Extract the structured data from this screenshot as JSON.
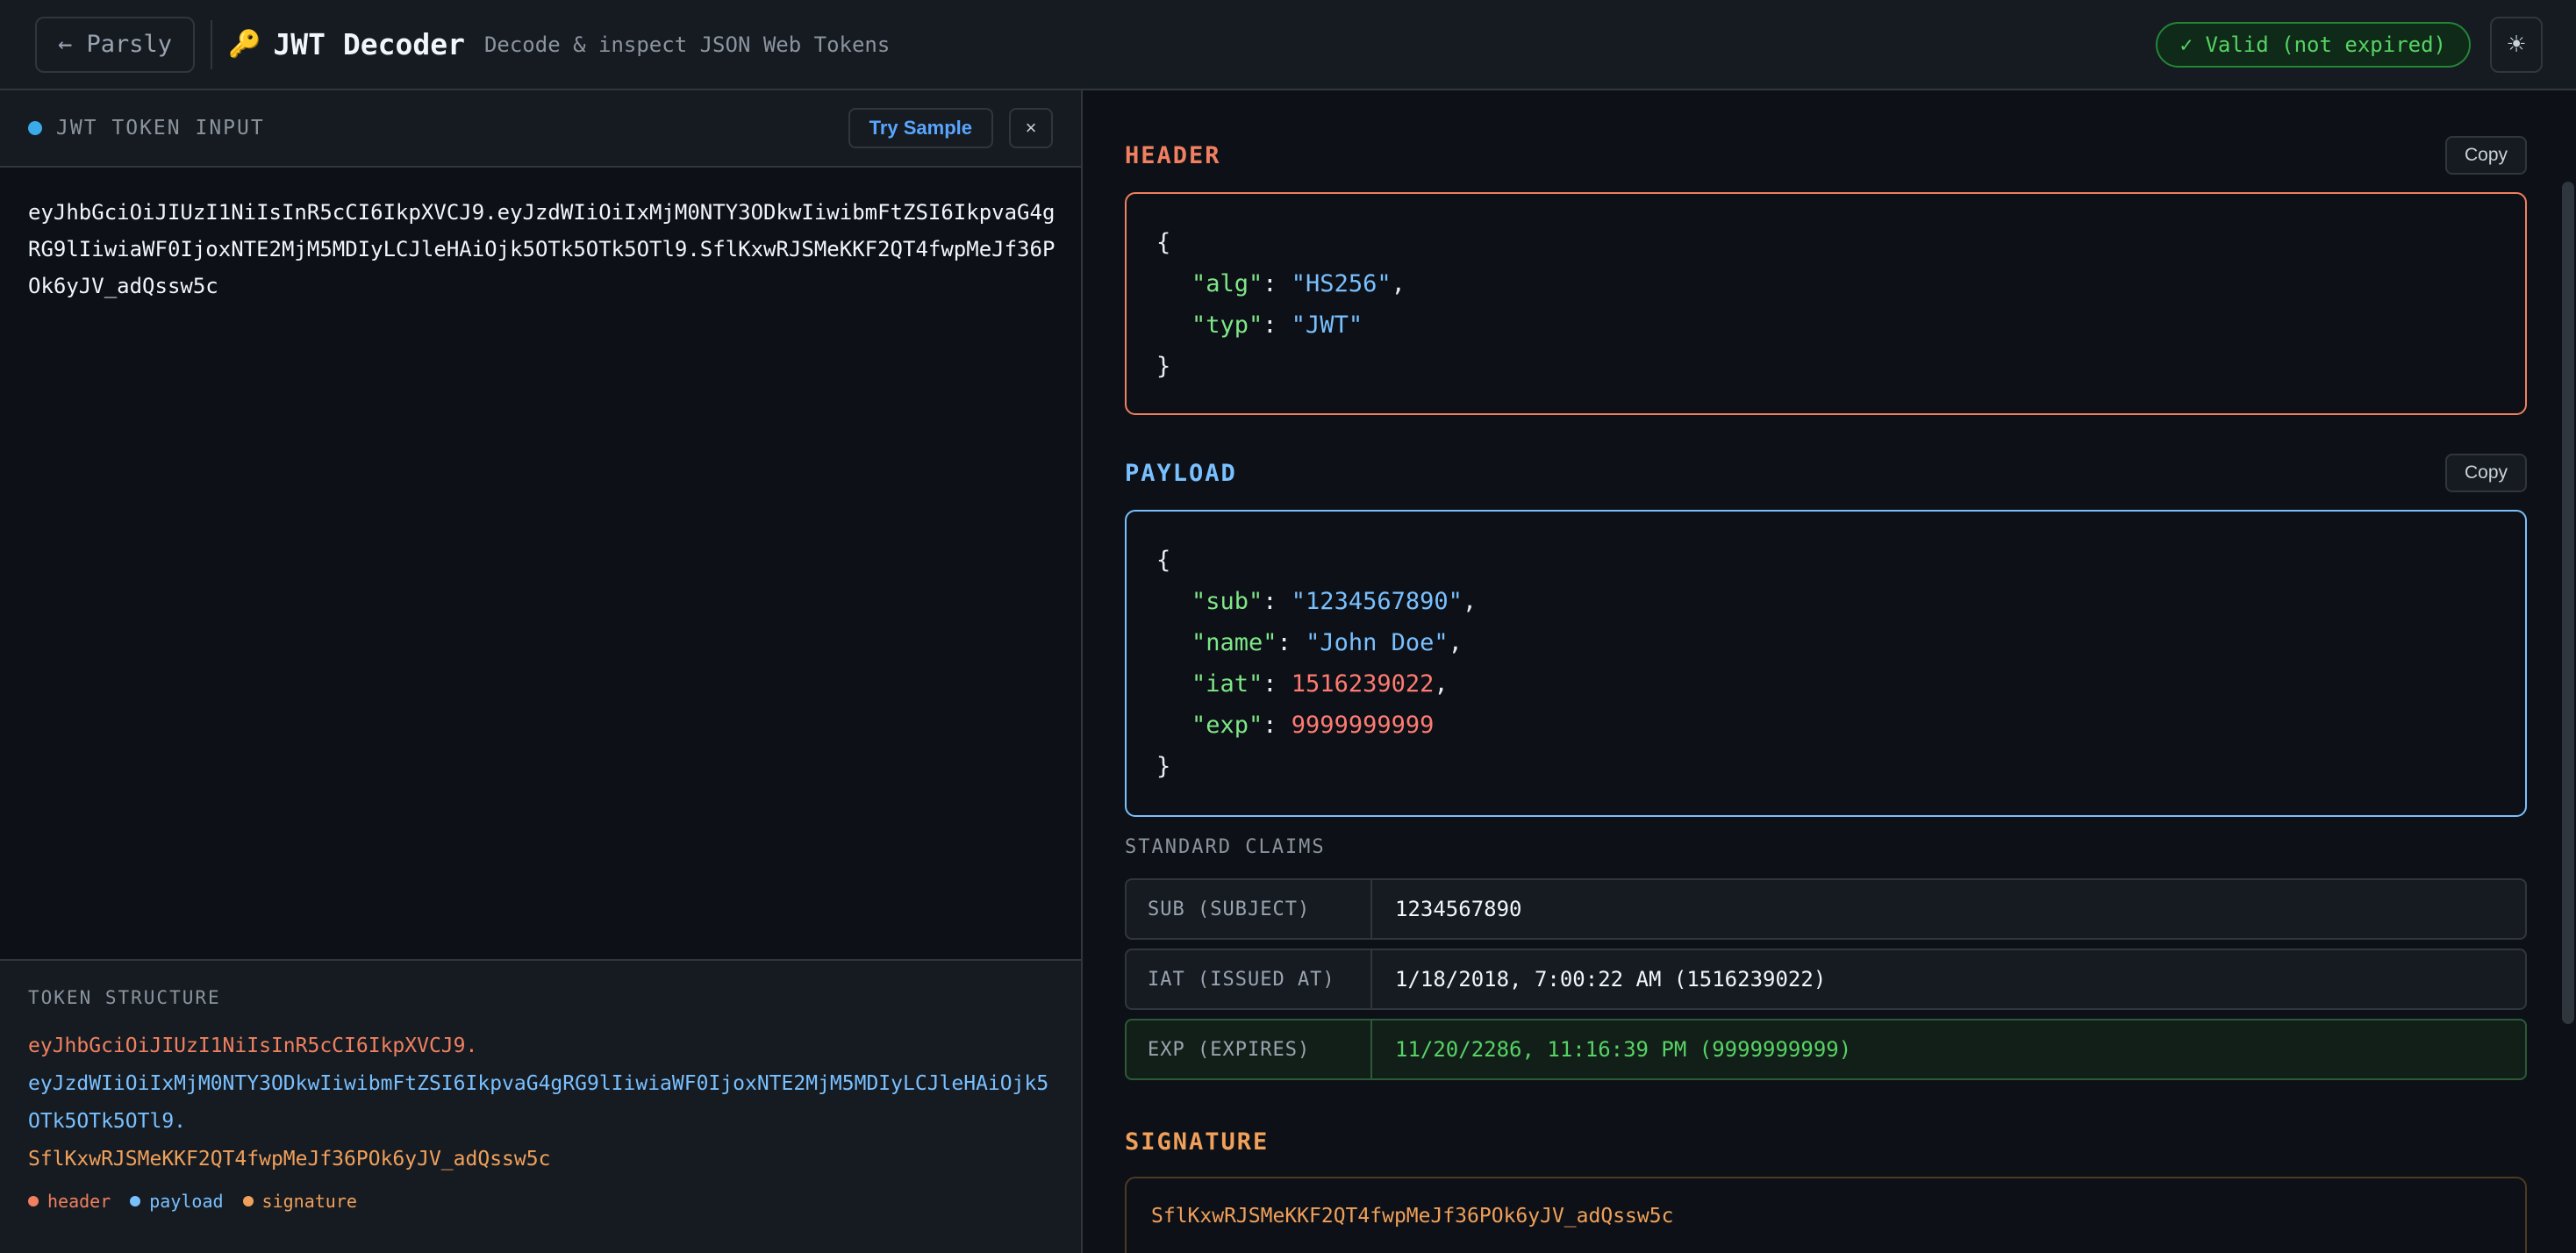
{
  "topbar": {
    "back_label": "← Parsly",
    "icon": "key-icon",
    "title": "JWT Decoder",
    "subtitle": "Decode & inspect JSON Web Tokens",
    "status": "✓ Valid (not expired)",
    "theme_icon": "☀"
  },
  "input_panel": {
    "title": "JWT TOKEN INPUT",
    "sample_label": "Try Sample",
    "clear_label": "×",
    "token": "eyJhbGciOiJIUzI1NiIsInR5cCI6IkpXVCJ9.eyJzdWIiOiIxMjM0NTY3ODkwIiwibmFtZSI6IkpvaG4gRG9lIiwiaWF0IjoxNTE2MjM5MDIyLCJleHAiOjk5OTk5OTk5OTl9.SflKxwRJSMeKKF2QT4fwpMeJf36POk6yJV_adQssw5c"
  },
  "structure": {
    "title": "TOKEN STRUCTURE",
    "header_seg": "eyJhbGciOiJIUzI1NiIsInR5cCI6IkpXVCJ9.",
    "payload_seg": "eyJzdWIiOiIxMjM0NTY3ODkwIiwibmFtZSI6IkpvaG4gRG9lIiwiaWF0IjoxNTE2MjM5MDIyLCJleHAiOjk5OTk5OTk5OTl9.",
    "signature_seg": "SflKxwRJSMeKKF2QT4fwpMeJf36POk6yJV_adQssw5c",
    "legend": [
      "header",
      "payload",
      "signature"
    ]
  },
  "header_section": {
    "title": "HEADER",
    "copy_label": "Copy",
    "fields": [
      {
        "key": "\"alg\"",
        "value": "\"HS256\"",
        "sep": ","
      },
      {
        "key": "\"typ\"",
        "value": "\"JWT\"",
        "sep": ""
      }
    ]
  },
  "payload_section": {
    "title": "PAYLOAD",
    "copy_label": "Copy",
    "fields": [
      {
        "key": "\"sub\"",
        "value": "\"1234567890\"",
        "sep": ","
      },
      {
        "key": "\"name\"",
        "value": "\"John Doe\"",
        "sep": ","
      },
      {
        "key": "\"iat\"",
        "value": "1516239022",
        "sep": ","
      },
      {
        "key": "\"exp\"",
        "value": "9999999999",
        "sep": ""
      }
    ]
  },
  "claims": {
    "title": "STANDARD CLAIMS",
    "rows": [
      {
        "key": "SUB (SUBJECT)",
        "value": "1234567890"
      },
      {
        "key": "IAT (ISSUED AT)",
        "value": "1/18/2018, 7:00:22 AM (1516239022)"
      },
      {
        "key": "EXP (EXPIRES)",
        "value": "11/20/2286, 11:16:39 PM (9999999999)"
      }
    ]
  },
  "signature_section": {
    "title": "SIGNATURE",
    "value": "SflKxwRJSMeKKF2QT4fwpMeJf36POk6yJV_adQssw5c"
  },
  "colors": {
    "background": "#0d1117",
    "header": "#f0805f",
    "payload": "#79c0ff",
    "signature": "#f0a05a",
    "valid": "#56d364"
  }
}
